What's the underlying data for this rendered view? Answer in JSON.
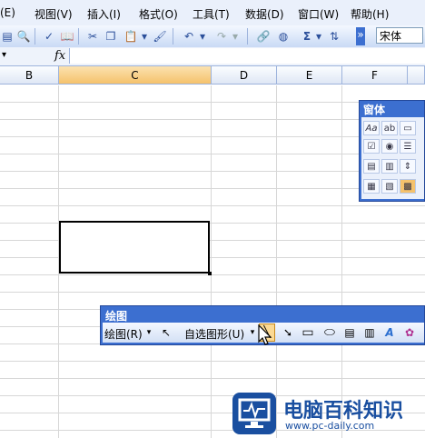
{
  "menu": [
    "(E)",
    "视图(V)",
    "插入(I)",
    "格式(O)",
    "工具(T)",
    "数据(D)",
    "窗口(W)",
    "帮助(H)"
  ],
  "toolbar": {
    "font_name": "宋体",
    "icons": [
      "print-preview-icon",
      "spelling-icon",
      "cut-icon",
      "copy-icon",
      "paste-icon",
      "format-painter-icon",
      "undo-icon",
      "redo-icon",
      "hyperlink-icon",
      "chart-icon",
      "autosum-icon",
      "sort-icon"
    ],
    "sigma": "Σ"
  },
  "formula_bar": {
    "fx": "fx",
    "value": ""
  },
  "columns": [
    "B",
    "C",
    "D",
    "E",
    "F"
  ],
  "active_column": "C",
  "forms_toolbar": {
    "title": "窗体"
  },
  "drawing_toolbar": {
    "title": "绘图",
    "draw_menu": "绘图(R)",
    "autoshapes_menu": "自选图形(U)"
  },
  "logo": {
    "title": "电脑百科知识",
    "url": "www.pc-daily.com"
  }
}
